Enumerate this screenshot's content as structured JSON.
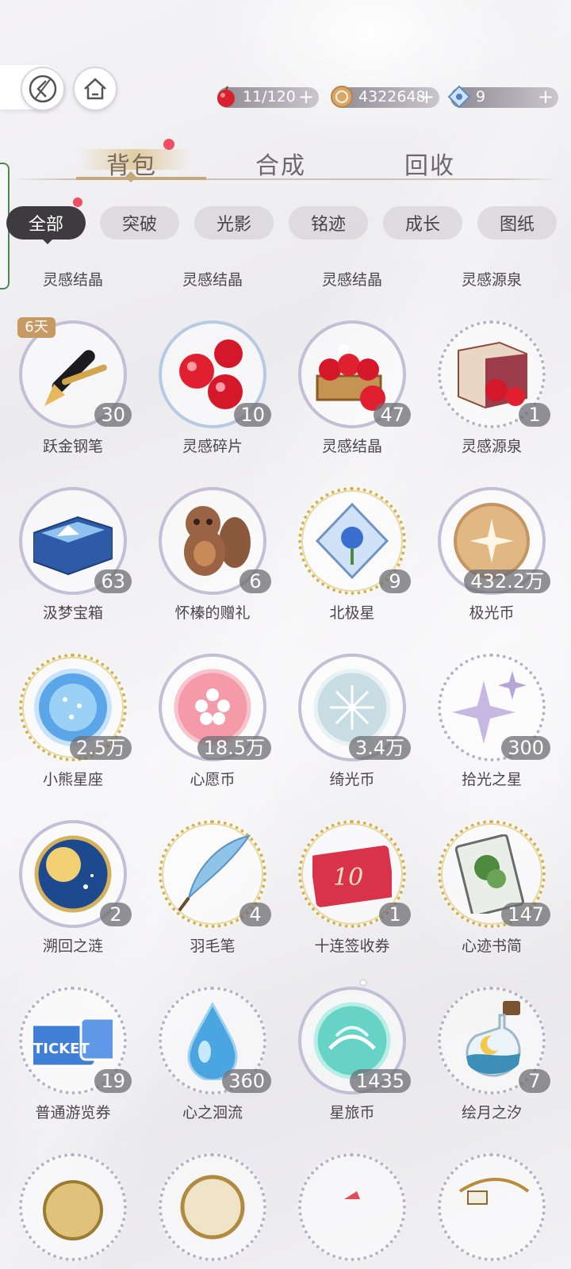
{
  "currencies": {
    "apples": {
      "value": "11/120",
      "plus": "+"
    },
    "coins": {
      "value": "4322648",
      "plus": "+"
    },
    "stars": {
      "value": "9",
      "plus": "+"
    }
  },
  "tabs": {
    "bag": "背包",
    "craft": "合成",
    "recycle": "回收"
  },
  "filters": [
    "全部",
    "突破",
    "光影",
    "铭迹",
    "成长",
    "图纸"
  ],
  "partial_row": [
    "灵感结晶",
    "灵感结晶",
    "灵感结晶",
    "灵感源泉"
  ],
  "items": [
    {
      "name": "跃金钢笔",
      "count": "30",
      "badge": "6天",
      "icon": "pen-icon"
    },
    {
      "name": "灵感碎片",
      "count": "10",
      "icon": "apples-icon"
    },
    {
      "name": "灵感结晶",
      "count": "47",
      "icon": "apple-basket-icon"
    },
    {
      "name": "灵感源泉",
      "count": "1",
      "icon": "apple-box-icon"
    },
    {
      "name": "汲梦宝箱",
      "count": "63",
      "icon": "dream-chest-icon"
    },
    {
      "name": "怀榛的赠礼",
      "count": "6",
      "icon": "squirrel-icon"
    },
    {
      "name": "北极星",
      "count": "9",
      "icon": "polaris-crystal-icon"
    },
    {
      "name": "极光币",
      "count": "432.2万",
      "icon": "aurora-coin-icon"
    },
    {
      "name": "小熊星座",
      "count": "2.5万",
      "icon": "ursa-coin-icon"
    },
    {
      "name": "心愿币",
      "count": "18.5万",
      "icon": "wish-coin-icon"
    },
    {
      "name": "绮光币",
      "count": "3.4万",
      "icon": "silver-coin-icon"
    },
    {
      "name": "拾光之星",
      "count": "300",
      "icon": "sparkle-star-icon"
    },
    {
      "name": "溯回之涟",
      "count": "2",
      "icon": "sun-moon-coin-icon"
    },
    {
      "name": "羽毛笔",
      "count": "4",
      "icon": "quill-icon"
    },
    {
      "name": "十连签收券",
      "count": "1",
      "icon": "ten-ticket-icon"
    },
    {
      "name": "心迹书简",
      "count": "147",
      "icon": "letter-card-icon"
    },
    {
      "name": "普通游览券",
      "count": "19",
      "icon": "tour-ticket-icon"
    },
    {
      "name": "心之洄流",
      "count": "360",
      "icon": "water-drop-icon"
    },
    {
      "name": "星旅币",
      "count": "1435",
      "icon": "teal-coin-icon"
    },
    {
      "name": "绘月之汐",
      "count": "7",
      "icon": "moon-bottle-icon"
    }
  ],
  "colors": {
    "accent": "#c5a87a",
    "dark_chip": "#3e3b40",
    "notify": "#f04e62"
  }
}
